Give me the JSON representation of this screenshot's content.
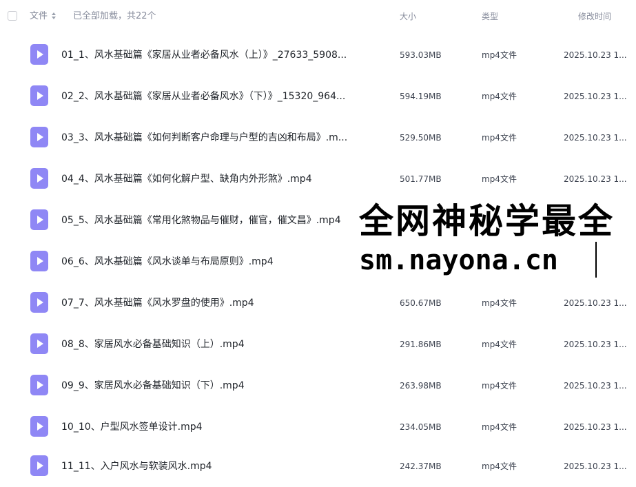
{
  "header": {
    "file_label": "文件",
    "loaded_text": "已全部加载，共22个",
    "size_label": "大小",
    "type_label": "类型",
    "modified_label": "修改时间"
  },
  "files": [
    {
      "name": "01_1、风水基础篇《家居从业者必备风水（上）》_27633_5908...",
      "size": "593.03MB",
      "type": "mp4文件",
      "modified": "2025.10.23 1..."
    },
    {
      "name": "02_2、风水基础篇《家居从业者必备风水》（下）》_15320_964...",
      "size": "594.19MB",
      "type": "mp4文件",
      "modified": "2025.10.23 1..."
    },
    {
      "name": "03_3、风水基础篇《如何判断客户命理与户型的吉凶和布局》.m...",
      "size": "529.50MB",
      "type": "mp4文件",
      "modified": "2025.10.23 1..."
    },
    {
      "name": "04_4、风水基础篇《如何化解户型、缺角内外形煞》.mp4",
      "size": "501.77MB",
      "type": "mp4文件",
      "modified": "2025.10.23 1..."
    },
    {
      "name": "05_5、风水基础篇《常用化煞物品与催财，催官，催文昌》.mp4",
      "size": "",
      "type": "",
      "modified": ""
    },
    {
      "name": "06_6、风水基础篇《风水谈单与布局原则》.mp4",
      "size": "",
      "type": "",
      "modified": ""
    },
    {
      "name": "07_7、风水基础篇《风水罗盘的使用》.mp4",
      "size": "650.67MB",
      "type": "mp4文件",
      "modified": "2025.10.23 1..."
    },
    {
      "name": "08_8、家居风水必备基础知识（上）.mp4",
      "size": "291.86MB",
      "type": "mp4文件",
      "modified": "2025.10.23 1..."
    },
    {
      "name": "09_9、家居风水必备基础知识（下）.mp4",
      "size": "263.98MB",
      "type": "mp4文件",
      "modified": "2025.10.23 1..."
    },
    {
      "name": "10_10、户型风水签单设计.mp4",
      "size": "234.05MB",
      "type": "mp4文件",
      "modified": "2025.10.23 1..."
    },
    {
      "name": "11_11、入户风水与软装风水.mp4",
      "size": "242.37MB",
      "type": "mp4文件",
      "modified": "2025.10.23 1..."
    }
  ],
  "watermark": {
    "line1": "全网神秘学最全",
    "line2": "sm.nayona.cn"
  },
  "colors": {
    "accent_icon": "#8f87f5",
    "header_text": "#878c9c",
    "row_text": "#1f2329"
  }
}
